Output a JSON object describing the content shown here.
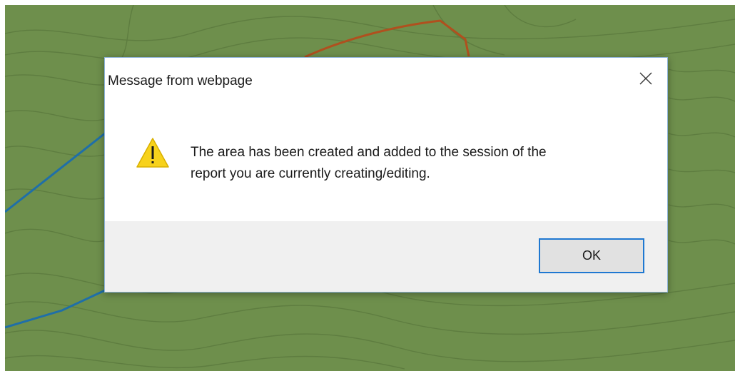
{
  "dialog": {
    "title": "Message from webpage",
    "message_line1": "The area has been created and added to the session of the",
    "message_line2": "report you are currently creating/editing.",
    "ok_label": "OK",
    "icon": "warning-icon",
    "close_icon": "close-icon"
  },
  "colors": {
    "map_background": "#6e8f4c",
    "contour": "#5c7a3e",
    "boundary_blue": "#1f6fa8",
    "boundary_brown": "#b0501e",
    "button_border": "#1f78d1",
    "footer_background": "#f0f0f0",
    "warning_fill": "#f7d21c"
  }
}
